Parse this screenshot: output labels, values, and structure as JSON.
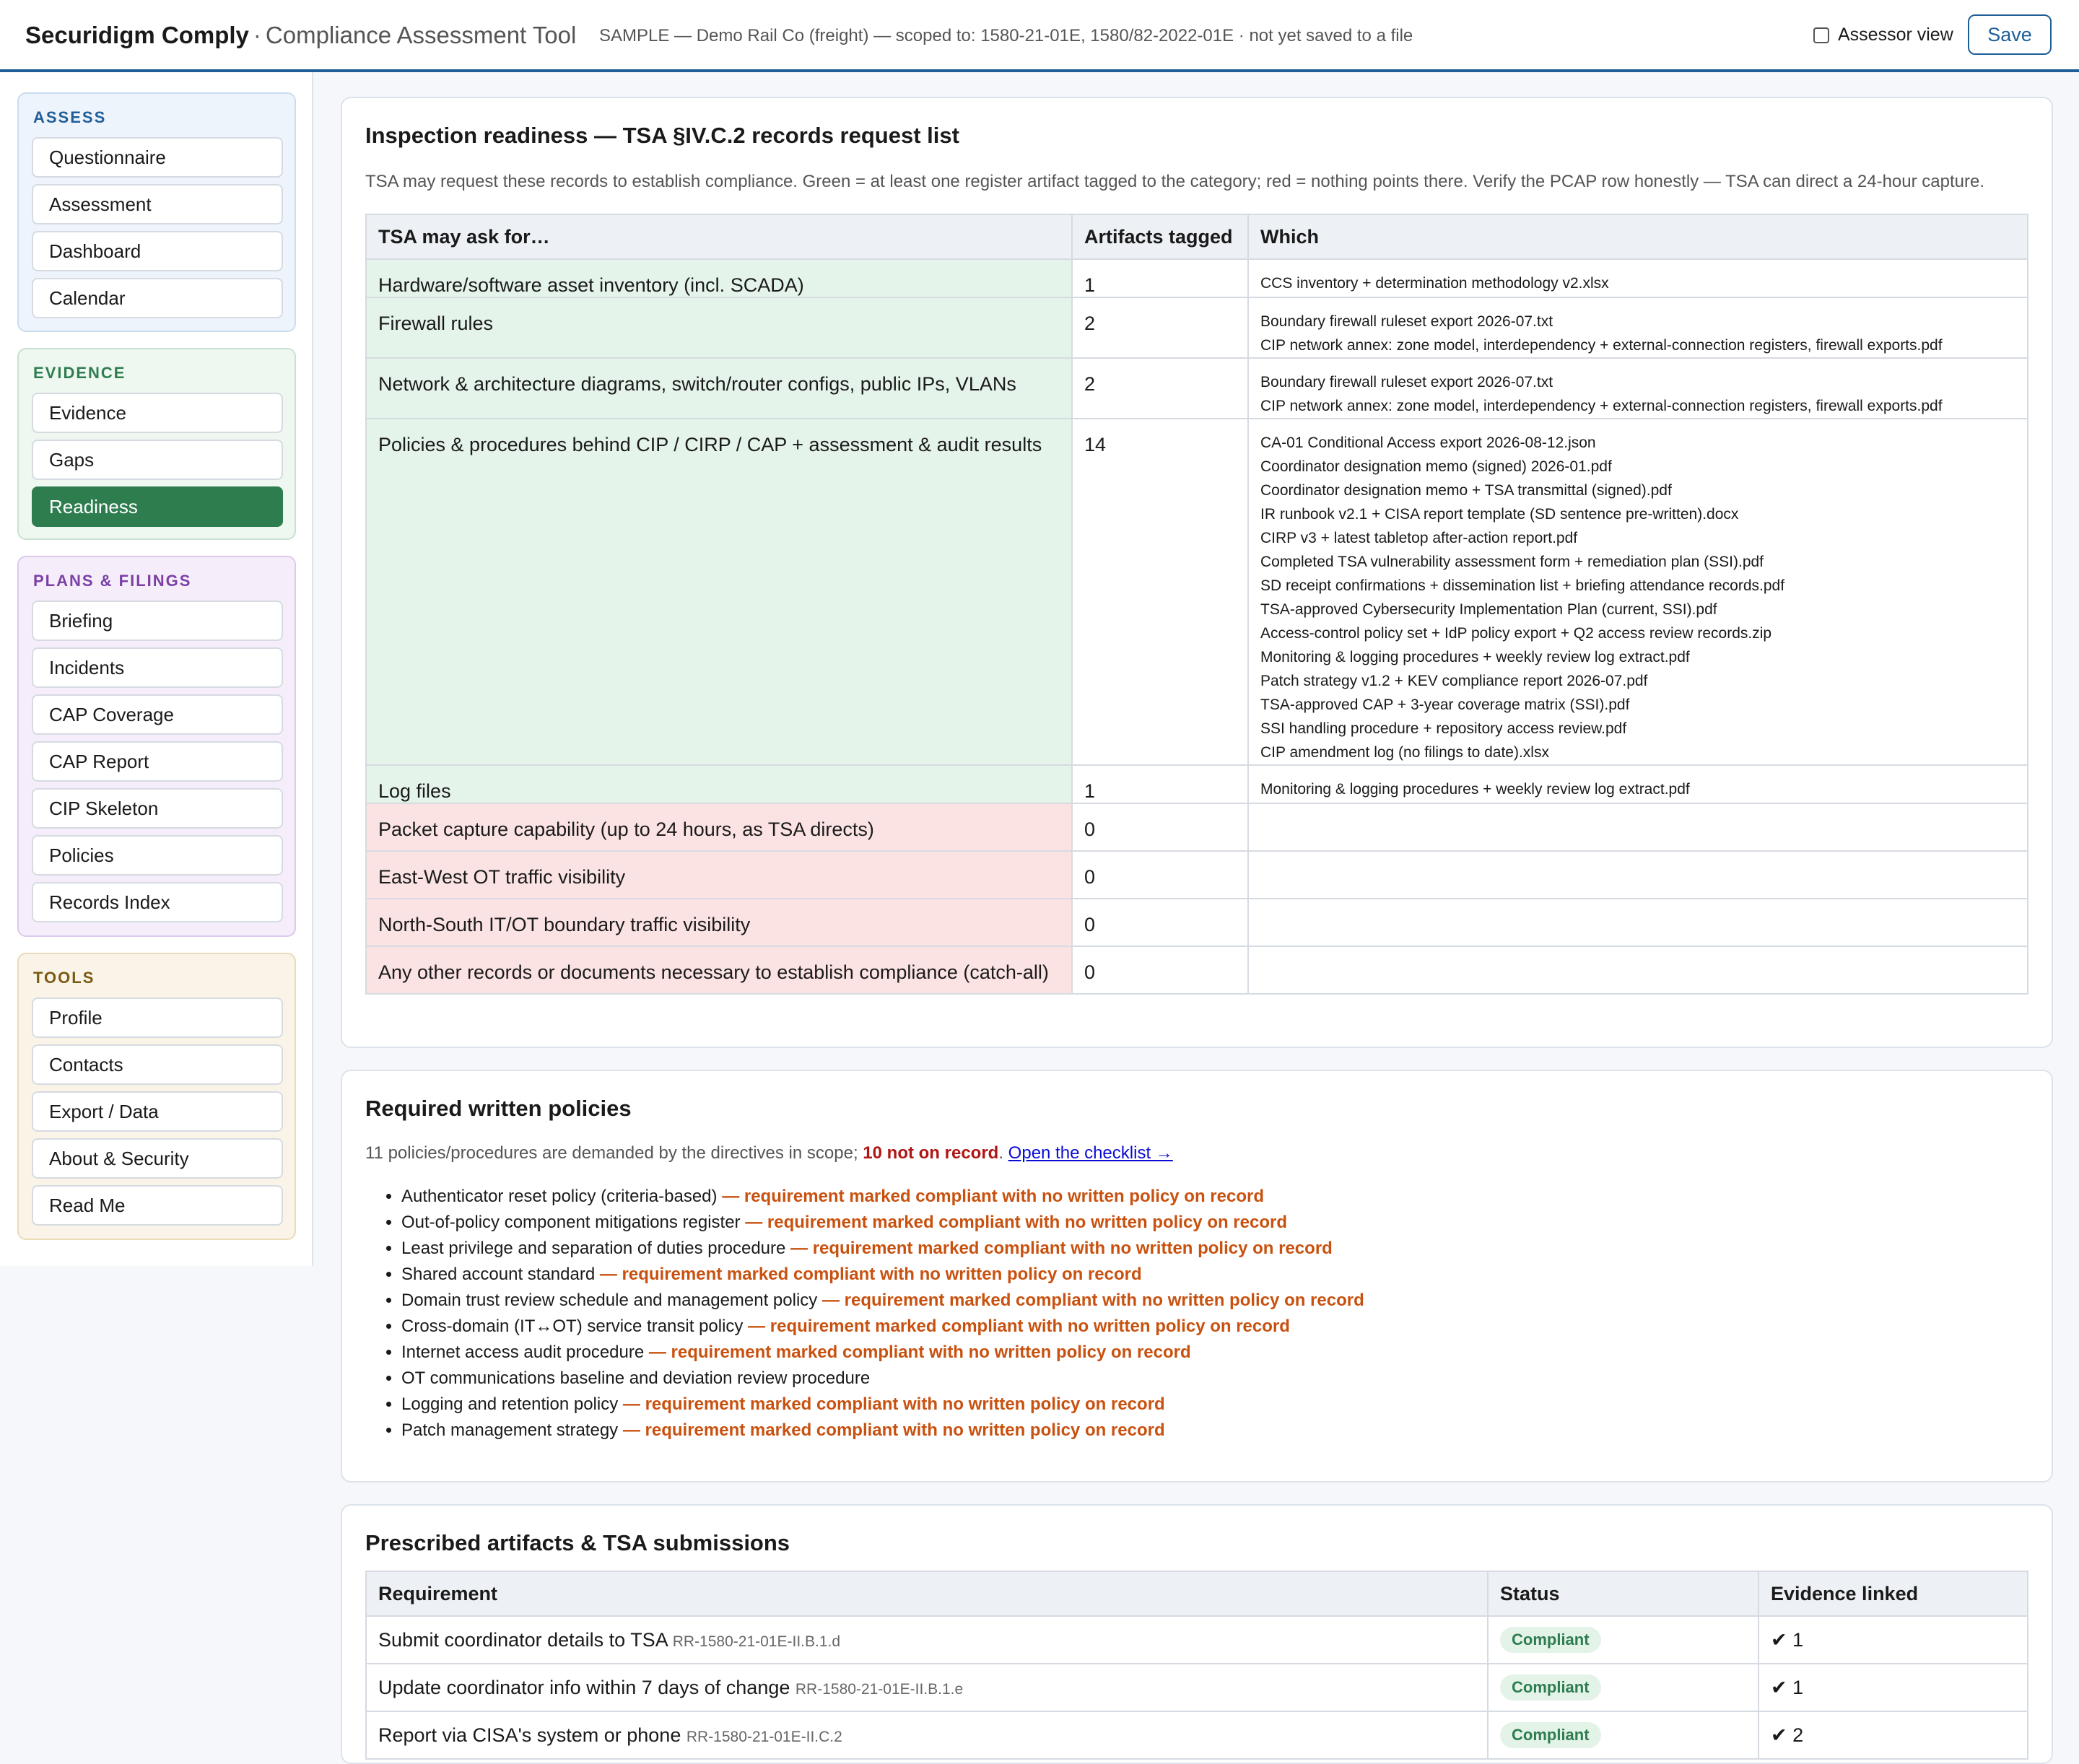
{
  "header": {
    "brand": "Securidigm Comply",
    "separator": "·",
    "subtitle": "Compliance Assessment Tool",
    "scope": "SAMPLE — Demo Rail Co (freight) — scoped to: 1580-21-01E, 1580/82-2022-01E · not yet saved to a file",
    "assessor_label": "Assessor view",
    "save_label": "Save"
  },
  "sidebar": {
    "assess": {
      "title": "ASSESS",
      "items": [
        "Questionnaire",
        "Assessment",
        "Dashboard",
        "Calendar"
      ]
    },
    "evidence": {
      "title": "EVIDENCE",
      "items": [
        "Evidence",
        "Gaps",
        "Readiness"
      ]
    },
    "plans": {
      "title": "PLANS & FILINGS",
      "items": [
        "Briefing",
        "Incidents",
        "CAP Coverage",
        "CAP Report",
        "CIP Skeleton",
        "Policies",
        "Records Index"
      ]
    },
    "tools": {
      "title": "TOOLS",
      "items": [
        "Profile",
        "Contacts",
        "Export / Data",
        "About & Security",
        "Read Me"
      ]
    },
    "active": "Readiness"
  },
  "readiness": {
    "title": "Inspection readiness — TSA §IV.C.2 records request list",
    "description": "TSA may request these records to establish compliance. Green = at least one register artifact tagged to the category; red = nothing points there. Verify the PCAP row honestly — TSA can direct a 24-hour capture.",
    "columns": [
      "TSA may ask for…",
      "Artifacts tagged",
      "Which"
    ],
    "rows": [
      {
        "category": "Hardware/software asset inventory (incl. SCADA)",
        "count": "1",
        "status": "green",
        "files": [
          "CCS inventory + determination methodology v2.xlsx"
        ]
      },
      {
        "category": "Firewall rules",
        "count": "2",
        "status": "green",
        "files": [
          "Boundary firewall ruleset export 2026-07.txt",
          "CIP network annex: zone model, interdependency + external-connection registers, firewall exports.pdf"
        ]
      },
      {
        "category": "Network & architecture diagrams, switch/router configs, public IPs, VLANs",
        "count": "2",
        "status": "green",
        "files": [
          "Boundary firewall ruleset export 2026-07.txt",
          "CIP network annex: zone model, interdependency + external-connection registers, firewall exports.pdf"
        ]
      },
      {
        "category": "Policies & procedures behind CIP / CIRP / CAP + assessment & audit results",
        "count": "14",
        "status": "green",
        "files": [
          "CA-01 Conditional Access export 2026-08-12.json",
          "Coordinator designation memo (signed) 2026-01.pdf",
          "Coordinator designation memo + TSA transmittal (signed).pdf",
          "IR runbook v2.1 + CISA report template (SD sentence pre-written).docx",
          "CIRP v3 + latest tabletop after-action report.pdf",
          "Completed TSA vulnerability assessment form + remediation plan (SSI).pdf",
          "SD receipt confirmations + dissemination list + briefing attendance records.pdf",
          "TSA-approved Cybersecurity Implementation Plan (current, SSI).pdf",
          "Access-control policy set + IdP policy export + Q2 access review records.zip",
          "Monitoring & logging procedures + weekly review log extract.pdf",
          "Patch strategy v1.2 + KEV compliance report 2026-07.pdf",
          "TSA-approved CAP + 3-year coverage matrix (SSI).pdf",
          "SSI handling procedure + repository access review.pdf",
          "CIP amendment log (no filings to date).xlsx"
        ]
      },
      {
        "category": "Log files",
        "count": "1",
        "status": "green",
        "files": [
          "Monitoring & logging procedures + weekly review log extract.pdf"
        ]
      },
      {
        "category": "Packet capture capability (up to 24 hours, as TSA directs)",
        "count": "0",
        "status": "red",
        "files": []
      },
      {
        "category": "East-West OT traffic visibility",
        "count": "0",
        "status": "red",
        "files": []
      },
      {
        "category": "North-South IT/OT boundary traffic visibility",
        "count": "0",
        "status": "red",
        "files": []
      },
      {
        "category": "Any other records or documents necessary to establish compliance (catch-all)",
        "count": "0",
        "status": "red",
        "files": []
      }
    ]
  },
  "policies": {
    "title": "Required written policies",
    "lead_text": "11 policies/procedures are demanded by the directives in scope; ",
    "lead_strong": "10 not on record",
    "lead_sep": ". ",
    "link": "Open the checklist →",
    "warning": "— requirement marked compliant with no written policy on record",
    "items": [
      {
        "name": "Authenticator reset policy (criteria-based)",
        "flag": true
      },
      {
        "name": "Out-of-policy component mitigations register",
        "flag": true
      },
      {
        "name": "Least privilege and separation of duties procedure",
        "flag": true
      },
      {
        "name": "Shared account standard",
        "flag": true
      },
      {
        "name": "Domain trust review schedule and management policy",
        "flag": true
      },
      {
        "name": "Cross-domain (IT↔OT) service transit policy",
        "flag": true
      },
      {
        "name": "Internet access audit procedure",
        "flag": true
      },
      {
        "name": "OT communications baseline and deviation review procedure",
        "flag": false
      },
      {
        "name": "Logging and retention policy",
        "flag": true
      },
      {
        "name": "Patch management strategy",
        "flag": true
      }
    ]
  },
  "artifacts": {
    "title": "Prescribed artifacts & TSA submissions",
    "columns": [
      "Requirement",
      "Status",
      "Evidence linked"
    ],
    "rows": [
      {
        "requirement": "Submit coordinator details to TSA",
        "ref": "RR-1580-21-01E-II.B.1.d",
        "status": "Compliant",
        "evidence": "✔ 1"
      },
      {
        "requirement": "Update coordinator info within 7 days of change",
        "ref": "RR-1580-21-01E-II.B.1.e",
        "status": "Compliant",
        "evidence": "✔ 1"
      },
      {
        "requirement": "Report via CISA's system or phone",
        "ref": "RR-1580-21-01E-II.C.2",
        "status": "Compliant",
        "evidence": "✔ 2"
      }
    ]
  }
}
